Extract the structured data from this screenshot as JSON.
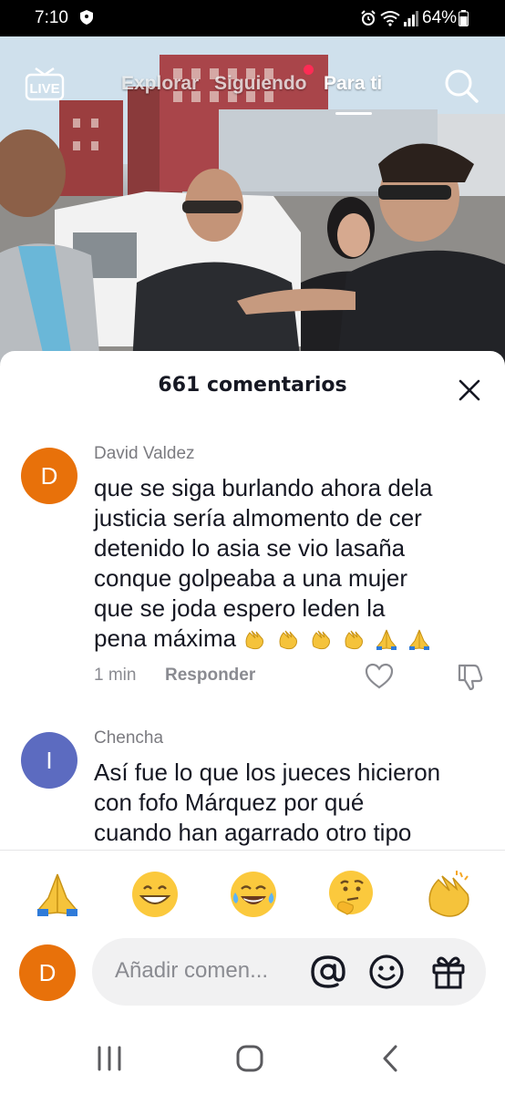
{
  "status_bar": {
    "time": "7:10",
    "battery": "64%",
    "icons": [
      "shield-icon",
      "alarm-icon",
      "wifi-icon",
      "signal-icon",
      "battery-icon"
    ]
  },
  "top_nav": {
    "live_label": "LIVE",
    "tabs": [
      {
        "label": "Explorar",
        "active": false
      },
      {
        "label": "Siguiendo",
        "active": false,
        "notification_dot": true
      },
      {
        "label": "Para ti",
        "active": true
      }
    ]
  },
  "comments_sheet": {
    "title": "661 comentarios",
    "comments": [
      {
        "avatar_letter": "D",
        "avatar_color": "#e8710a",
        "username": "David Valdez",
        "text_lines": [
          "que se siga burlando ahora dela",
          "justicia sería almomento de cer",
          "detenido lo asia se vio lasaña",
          "conque golpeaba a una mujer",
          "que se joda espero leden la",
          "pena máxima"
        ],
        "emojis": [
          "clap",
          "clap",
          "clap",
          "clap",
          "pray",
          "pray"
        ],
        "time": "1 min",
        "reply_label": "Responder"
      },
      {
        "avatar_letter": "I",
        "avatar_color": "#5c6bc0",
        "username": "Chencha",
        "text_lines": [
          "Así fue lo que los jueces hicieron",
          "con fofo Márquez por qué",
          "cuando han agarrado otro tipo"
        ]
      }
    ]
  },
  "composer": {
    "quick_emojis": [
      "pray",
      "grin",
      "joy",
      "thinking",
      "clap"
    ],
    "my_avatar_letter": "D",
    "placeholder": "Añadir comen..."
  },
  "colors": {
    "accent": "#fe2c55",
    "avatar_orange": "#e8710a",
    "avatar_indigo": "#5c6bc0"
  }
}
